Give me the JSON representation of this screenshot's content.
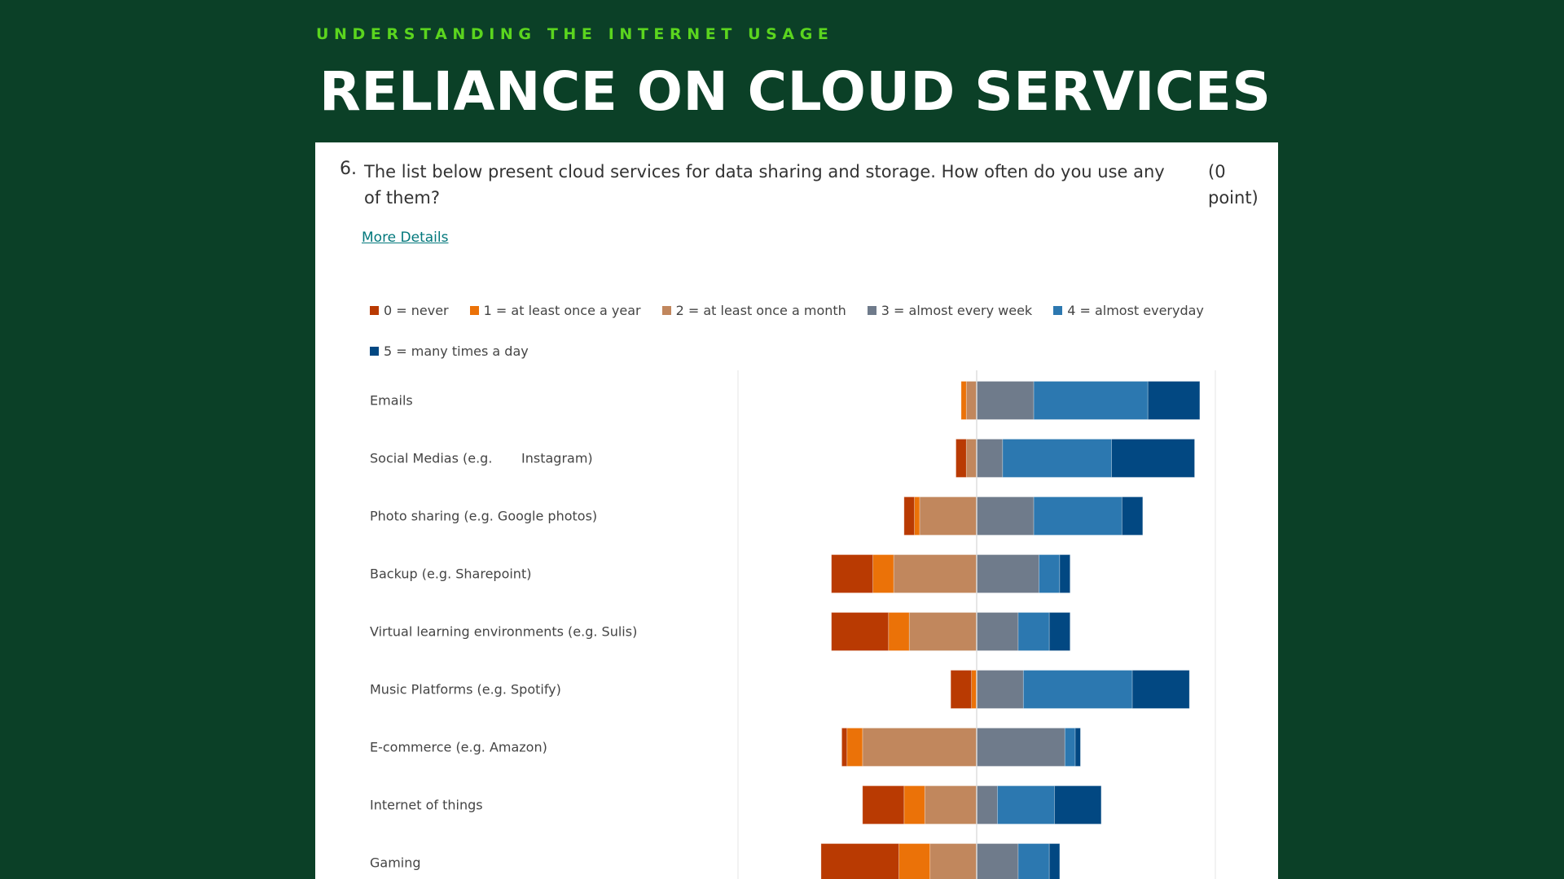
{
  "header": {
    "subtitle": "UNDERSTANDING THE INTERNET USAGE",
    "title": "RELIANCE ON CLOUD SERVICES"
  },
  "question": {
    "number": "6.",
    "text": "The list below present cloud services for data sharing and storage. How often do you use any of them?",
    "points": "(0 point)",
    "more_details_label": "More Details"
  },
  "chart_data": {
    "type": "bar",
    "orientation": "horizontal",
    "stacking": "diverging",
    "title": "",
    "xlabel": "",
    "ylabel": "",
    "xlim": [
      -46,
      46
    ],
    "legend_position": "top-left",
    "grid": true,
    "categories": [
      "Emails",
      "Social Medias (e.g.       Instagram)",
      "Photo sharing (e.g. Google photos)",
      "Backup (e.g. Sharepoint)",
      "Virtual learning environments (e.g. Sulis)",
      "Music Platforms (e.g. Spotify)",
      "E-commerce (e.g. Amazon)",
      "Internet of things",
      "Gaming"
    ],
    "series": [
      {
        "name": "0 = never",
        "color": "#b93a02",
        "side": "negative",
        "values": [
          0,
          2,
          2,
          8,
          11,
          4,
          1,
          8,
          15
        ]
      },
      {
        "name": "1 = at least once a year",
        "color": "#eb7208",
        "side": "negative",
        "values": [
          1,
          0,
          1,
          4,
          4,
          1,
          3,
          4,
          6
        ]
      },
      {
        "name": "2 = at least once a month",
        "color": "#c1875d",
        "side": "negative",
        "values": [
          2,
          2,
          11,
          16,
          13,
          0,
          22,
          10,
          9
        ]
      },
      {
        "name": "3 = almost every week",
        "color": "#6f7b8b",
        "side": "positive",
        "values": [
          11,
          5,
          11,
          12,
          8,
          9,
          17,
          4,
          8
        ]
      },
      {
        "name": "4 = almost everyday",
        "color": "#2c78b0",
        "side": "positive",
        "values": [
          22,
          21,
          17,
          4,
          6,
          21,
          2,
          11,
          6
        ]
      },
      {
        "name": "5 = many times a day",
        "color": "#024882",
        "side": "positive",
        "values": [
          10,
          16,
          4,
          2,
          4,
          11,
          1,
          9,
          2
        ]
      }
    ]
  }
}
